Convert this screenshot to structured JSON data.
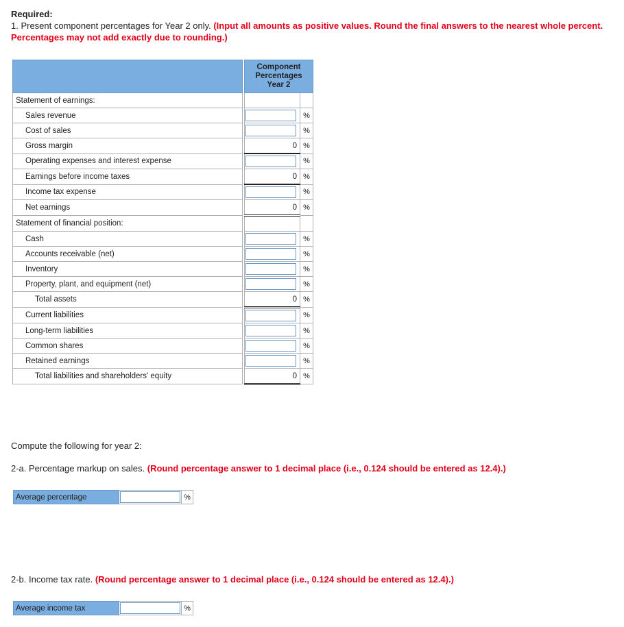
{
  "header": {
    "required_label": "Required:",
    "instruction_prefix": "1. Present component percentages for Year 2 only. ",
    "instruction_red": "(Input all amounts as positive values. Round the final answers to the nearest whole percent. Percentages may not add exactly due to rounding.)"
  },
  "table": {
    "column_header_line1": "Component",
    "column_header_line2": "Percentages",
    "column_header_line3": "Year 2",
    "pct_symbol": "%",
    "rows": [
      {
        "label": "Statement of earnings:",
        "indent": 0,
        "type": "section",
        "value": ""
      },
      {
        "label": "Sales revenue",
        "indent": 1,
        "type": "input",
        "value": ""
      },
      {
        "label": "Cost of sales",
        "indent": 1,
        "type": "input",
        "value": ""
      },
      {
        "label": "Gross margin",
        "indent": 1,
        "type": "computed",
        "value": "0"
      },
      {
        "label": "Operating expenses and interest expense",
        "indent": 1,
        "type": "input",
        "value": ""
      },
      {
        "label": "Earnings before income taxes",
        "indent": 1,
        "type": "computed",
        "value": "0"
      },
      {
        "label": "Income tax expense",
        "indent": 1,
        "type": "input",
        "value": ""
      },
      {
        "label": "Net earnings",
        "indent": 1,
        "type": "computed-total",
        "value": "0"
      },
      {
        "label": "Statement of financial position:",
        "indent": 0,
        "type": "section",
        "value": ""
      },
      {
        "label": "Cash",
        "indent": 1,
        "type": "input",
        "value": ""
      },
      {
        "label": "Accounts receivable (net)",
        "indent": 1,
        "type": "input",
        "value": ""
      },
      {
        "label": "Inventory",
        "indent": 1,
        "type": "input",
        "value": ""
      },
      {
        "label": "Property, plant, and equipment (net)",
        "indent": 1,
        "type": "input",
        "value": ""
      },
      {
        "label": "Total assets",
        "indent": 2,
        "type": "computed-total",
        "value": "0"
      },
      {
        "label": "Current liabilities",
        "indent": 1,
        "type": "input",
        "value": ""
      },
      {
        "label": "Long-term liabilities",
        "indent": 1,
        "type": "input",
        "value": ""
      },
      {
        "label": "Common shares",
        "indent": 1,
        "type": "input",
        "value": ""
      },
      {
        "label": "Retained earnings",
        "indent": 1,
        "type": "input",
        "value": ""
      },
      {
        "label": "Total liabilities and shareholders' equity",
        "indent": 2,
        "type": "computed-total",
        "value": "0"
      }
    ]
  },
  "section2": {
    "intro": "Compute the following for year 2:",
    "q2a_prefix": "2-a. Percentage markup on sales. ",
    "q2a_red": "(Round percentage answer to 1 decimal place (i.e., 0.124 should be entered as 12.4).)",
    "q2a_label": "Average percentage",
    "q2a_value": "",
    "q2b_prefix": "2-b. Income tax rate. ",
    "q2b_red": "(Round percentage answer to 1 decimal place (i.e., 0.124 should be entered as 12.4).)",
    "q2b_label": "Average income tax",
    "q2b_value": "",
    "pct_symbol": "%"
  }
}
